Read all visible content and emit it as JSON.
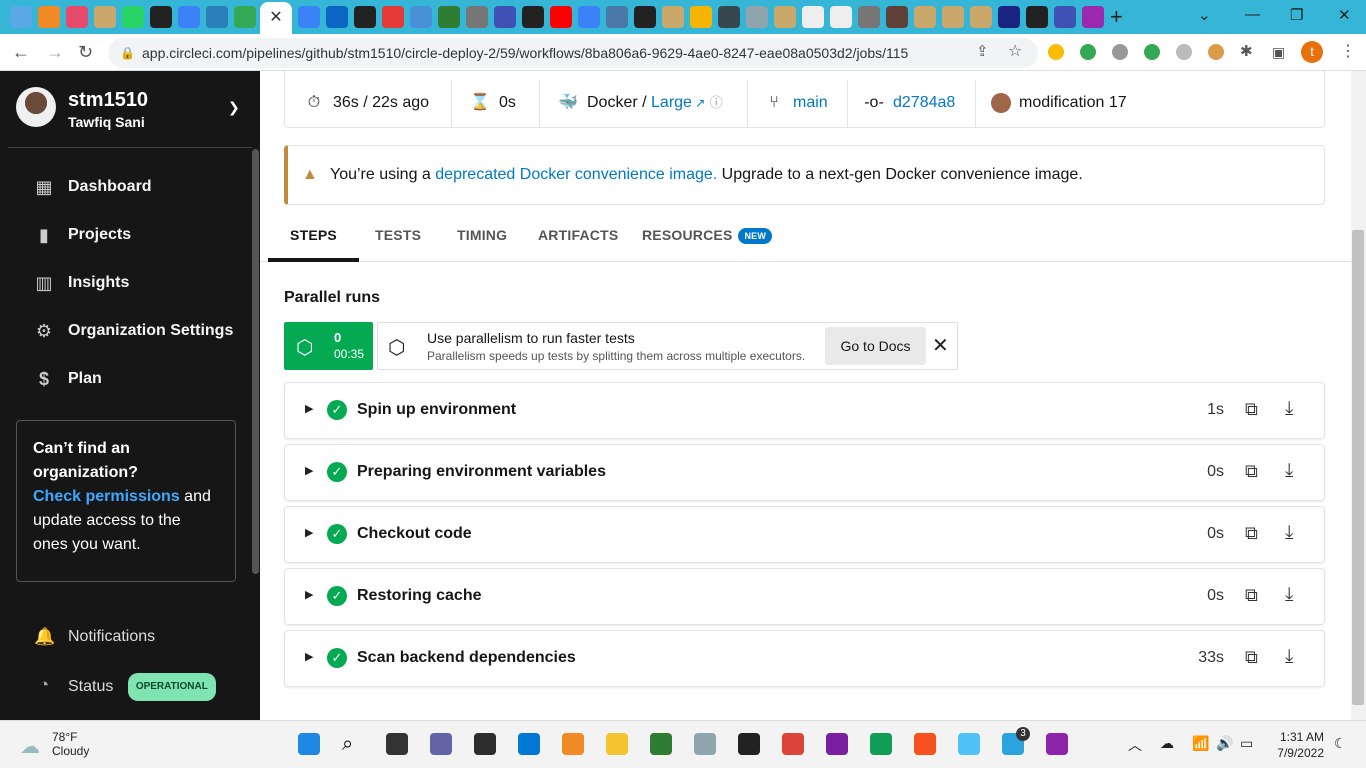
{
  "browser": {
    "url": "app.circleci.com/pipelines/github/stm1510/circle-deploy-2/59/workflows/8ba806a6-9629-4ae0-8247-eae08a0503d2/jobs/115",
    "profile_initial": "t",
    "tab_bar_color": "#35b6d6"
  },
  "sidebar": {
    "username": "stm1510",
    "fullname": "Tawfiq Sani",
    "nav": [
      {
        "label": "Dashboard",
        "icon": "dashboard-icon"
      },
      {
        "label": "Projects",
        "icon": "projects-icon"
      },
      {
        "label": "Insights",
        "icon": "insights-icon"
      },
      {
        "label": "Organization Settings",
        "icon": "gear-icon"
      },
      {
        "label": "Plan",
        "icon": "dollar-icon"
      }
    ],
    "org_box": {
      "heading": "Can’t find an organization?",
      "link": "Check permissions",
      "rest": " and update access to the ones you want."
    },
    "notifications": "Notifications",
    "status": "Status",
    "status_badge": "OPERATIONAL"
  },
  "job_info": {
    "duration": "36s / 22s ago",
    "queued": "0s",
    "executor_prefix": "Docker / ",
    "executor_size": "Large",
    "branch": "main",
    "commit": "d2784a8",
    "commit_msg": "modification 17"
  },
  "warning": {
    "prefix": "You’re using a ",
    "link": "deprecated Docker convenience image.",
    "suffix": " Upgrade to a next-gen Docker convenience image."
  },
  "tabs": [
    {
      "label": "STEPS",
      "active": true
    },
    {
      "label": "TESTS"
    },
    {
      "label": "TIMING"
    },
    {
      "label": "ARTIFACTS"
    },
    {
      "label": "RESOURCES"
    }
  ],
  "new_badge": "NEW",
  "parallel": {
    "title": "Parallel runs",
    "index": "0",
    "time": "00:35",
    "tip_title": "Use parallelism to run faster tests",
    "tip_body": "Parallelism speeds up tests by splitting them across multiple executors.",
    "docs_button": "Go to Docs"
  },
  "steps": [
    {
      "name": "Spin up environment",
      "duration": "1s"
    },
    {
      "name": "Preparing environment variables",
      "duration": "0s"
    },
    {
      "name": "Checkout code",
      "duration": "0s"
    },
    {
      "name": "Restoring cache",
      "duration": "0s"
    },
    {
      "name": "Scan backend dependencies",
      "duration": "33s"
    }
  ],
  "taskbar": {
    "temp": "78°F",
    "condition": "Cloudy",
    "time": "1:31 AM",
    "date": "7/9/2022",
    "telegram_badge": "3"
  },
  "colors": {
    "success": "#04aa51",
    "link": "#0078ca",
    "warning": "#c28b3b",
    "sidebar": "#161616"
  }
}
